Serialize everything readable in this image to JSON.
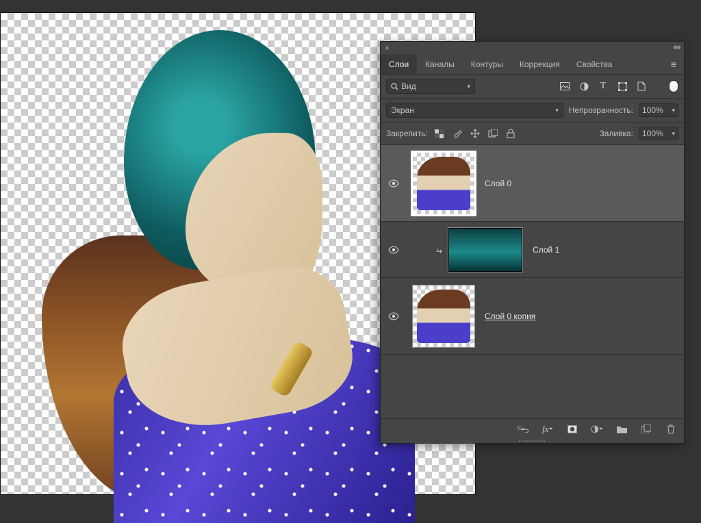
{
  "tabs": {
    "layers": "Слои",
    "channels": "Каналы",
    "paths": "Контуры",
    "adjustments": "Коррекция",
    "properties": "Свойства"
  },
  "filter": {
    "label": "Вид"
  },
  "blend": {
    "mode": "Экран",
    "opacity_label": "Непрозрачность:",
    "opacity_value": "100%"
  },
  "lock": {
    "label": "Закрепить:"
  },
  "fill": {
    "label": "Заливка:",
    "value": "100%"
  },
  "layers": [
    {
      "name": "Слой 0",
      "visible": true,
      "clipped": false,
      "selected": true,
      "thumb": "portrait"
    },
    {
      "name": "Слой 1",
      "visible": true,
      "clipped": true,
      "selected": false,
      "thumb": "sea"
    },
    {
      "name": "Слой 0 копия",
      "visible": true,
      "clipped": false,
      "selected": false,
      "thumb": "portrait",
      "underline": true
    }
  ],
  "icons": {
    "close": "close-icon",
    "collapse": "collapse-icon",
    "menu": "menu-icon",
    "search": "search-icon",
    "image_filter": "image-filter-icon",
    "adj_filter": "adjustment-filter-icon",
    "text_filter": "text-filter-icon",
    "shape_filter": "shape-filter-icon",
    "smart_filter": "smart-filter-icon",
    "swatch": "foreground-swatch",
    "lock_pixels": "lock-pixels-icon",
    "lock_brush": "lock-brush-icon",
    "lock_pos": "lock-position-icon",
    "lock_artboard": "lock-artboard-icon",
    "lock_all": "lock-all-icon",
    "visibility": "visibility-icon",
    "link": "link-icon",
    "fx": "fx-icon",
    "mask": "mask-icon",
    "adj_new": "new-adjustment-icon",
    "group": "group-icon",
    "new_layer": "new-layer-icon",
    "trash": "trash-icon"
  }
}
